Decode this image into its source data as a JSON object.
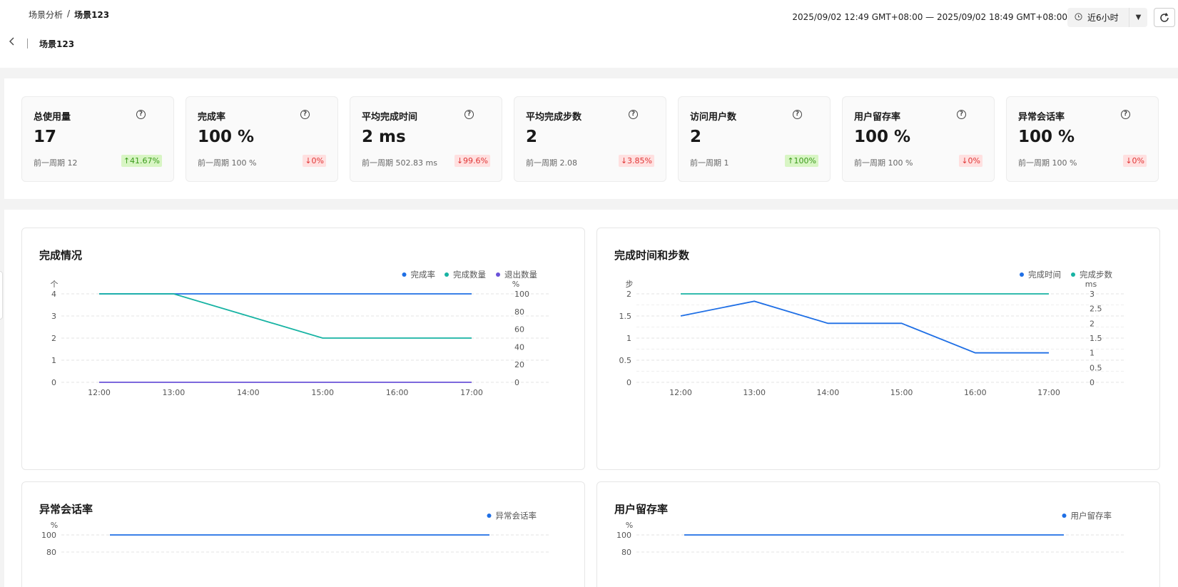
{
  "breadcrumb": {
    "parent": "场景分析",
    "sep": "/",
    "current": "场景123"
  },
  "header": {
    "title": "场景123"
  },
  "time_range": {
    "text": "2025/09/02 12:49 GMT+08:00 — 2025/09/02 18:49 GMT+08:00",
    "preset": "近6小时"
  },
  "icons": {
    "back": "chevron-left-icon",
    "clock": "clock-icon",
    "dropdown": "caret-down-icon",
    "refresh": "refresh-icon",
    "help": "question-circle-icon"
  },
  "kpis": [
    {
      "title": "总使用量",
      "value": "17",
      "prev": "前一周期 12",
      "change": "↑41.67%",
      "dir": "up"
    },
    {
      "title": "完成率",
      "value": "100 %",
      "prev": "前一周期 100 %",
      "change": "↓0%",
      "dir": "down"
    },
    {
      "title": "平均完成时间",
      "value": "2 ms",
      "prev": "前一周期 502.83 ms",
      "change": "↓99.6%",
      "dir": "down"
    },
    {
      "title": "平均完成步数",
      "value": "2",
      "prev": "前一周期 2.08",
      "change": "↓3.85%",
      "dir": "down"
    },
    {
      "title": "访问用户数",
      "value": "2",
      "prev": "前一周期 1",
      "change": "↑100%",
      "dir": "up"
    },
    {
      "title": "用户留存率",
      "value": "100 %",
      "prev": "前一周期 100 %",
      "change": "↓0%",
      "dir": "down"
    },
    {
      "title": "异常会话率",
      "value": "100 %",
      "prev": "前一周期 100 %",
      "change": "↓0%",
      "dir": "down"
    }
  ],
  "colors": {
    "blue": "#1f6fe5",
    "teal": "#17b3a3",
    "purple": "#6a52d8",
    "up_bg": "#d8f5c4",
    "down_bg": "#ffe0e0"
  },
  "chart_data": [
    {
      "title": "完成情况",
      "type": "line",
      "x": [
        "12:00",
        "13:00",
        "14:00",
        "15:00",
        "16:00",
        "17:00"
      ],
      "left_unit": "个",
      "left_ticks": [
        "0",
        "1",
        "2",
        "3",
        "4"
      ],
      "left_lim": [
        0,
        4
      ],
      "right_unit": "%",
      "right_ticks": [
        "0",
        "20",
        "40",
        "60",
        "80",
        "100"
      ],
      "right_lim": [
        0,
        100
      ],
      "series": [
        {
          "name": "完成率",
          "axis": "right",
          "color": "#1f6fe5",
          "values": [
            100,
            100,
            100,
            100,
            100,
            100
          ]
        },
        {
          "name": "完成数量",
          "axis": "left",
          "color": "#17b3a3",
          "values": [
            4,
            4,
            3,
            2,
            2,
            2
          ]
        },
        {
          "name": "退出数量",
          "axis": "left",
          "color": "#6a52d8",
          "values": [
            0,
            0,
            0,
            0,
            0,
            0
          ]
        }
      ],
      "legend": "top-right",
      "grid": true
    },
    {
      "title": "完成时间和步数",
      "type": "line",
      "x": [
        "12:00",
        "13:00",
        "14:00",
        "15:00",
        "16:00",
        "17:00"
      ],
      "left_unit": "步",
      "left_ticks": [
        "0",
        "0.5",
        "1",
        "1.5",
        "2"
      ],
      "left_lim": [
        0,
        2
      ],
      "right_unit": "ms",
      "right_ticks": [
        "0",
        "0.5",
        "1",
        "1.5",
        "2",
        "2.5",
        "3"
      ],
      "right_lim": [
        0,
        3
      ],
      "series": [
        {
          "name": "完成时间",
          "axis": "right",
          "color": "#1f6fe5",
          "values": [
            2.25,
            2.75,
            2,
            2,
            1,
            1
          ]
        },
        {
          "name": "完成步数",
          "axis": "left",
          "color": "#17b3a3",
          "values": [
            2,
            2,
            2,
            2,
            2,
            2
          ]
        }
      ],
      "legend": "top-right",
      "grid": true
    },
    {
      "title": "异常会话率",
      "type": "line",
      "left_unit": "%",
      "left_ticks": [
        "80",
        "100"
      ],
      "series": [
        {
          "name": "异常会话率",
          "color": "#1f6fe5",
          "values": [
            100,
            100,
            100,
            100,
            100,
            100
          ]
        }
      ],
      "legend": "top-right",
      "grid": true
    },
    {
      "title": "用户留存率",
      "type": "line",
      "left_unit": "%",
      "left_ticks": [
        "80",
        "100"
      ],
      "series": [
        {
          "name": "用户留存率",
          "color": "#1f6fe5",
          "values": [
            100,
            100,
            100,
            100,
            100,
            100
          ]
        }
      ],
      "legend": "top-right",
      "grid": true
    }
  ]
}
